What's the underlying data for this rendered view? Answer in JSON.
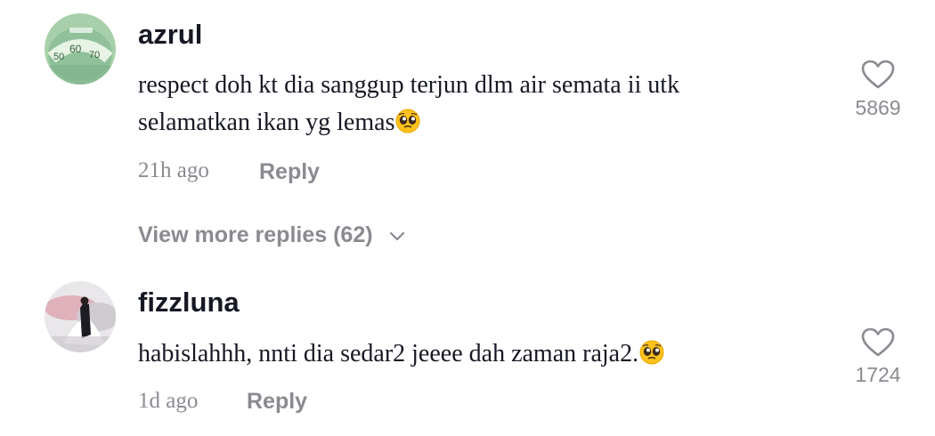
{
  "comments": [
    {
      "username": "azrul",
      "text_line1": "respect doh kt dia sanggup terjun dlm air semata ii utk",
      "text_line2": "selamatkan ikan yg lemas",
      "emoji": "pleading-face",
      "time": "21h ago",
      "reply_label": "Reply",
      "likes": "5869",
      "avatar": "scale-dial-photo"
    },
    {
      "username": "fizzluna",
      "text": "habislahhh, nnti dia sedar2 jeeee dah zaman raja2.",
      "emoji": "pleading-face",
      "time": "1d ago",
      "reply_label": "Reply",
      "likes": "1724",
      "avatar": "wedding-photo"
    }
  ],
  "view_more": {
    "label": "View more replies (62)",
    "icon": "chevron-down-icon"
  },
  "colors": {
    "text": "#161823",
    "secondary": "#8a8b91",
    "background": "#ffffff"
  }
}
